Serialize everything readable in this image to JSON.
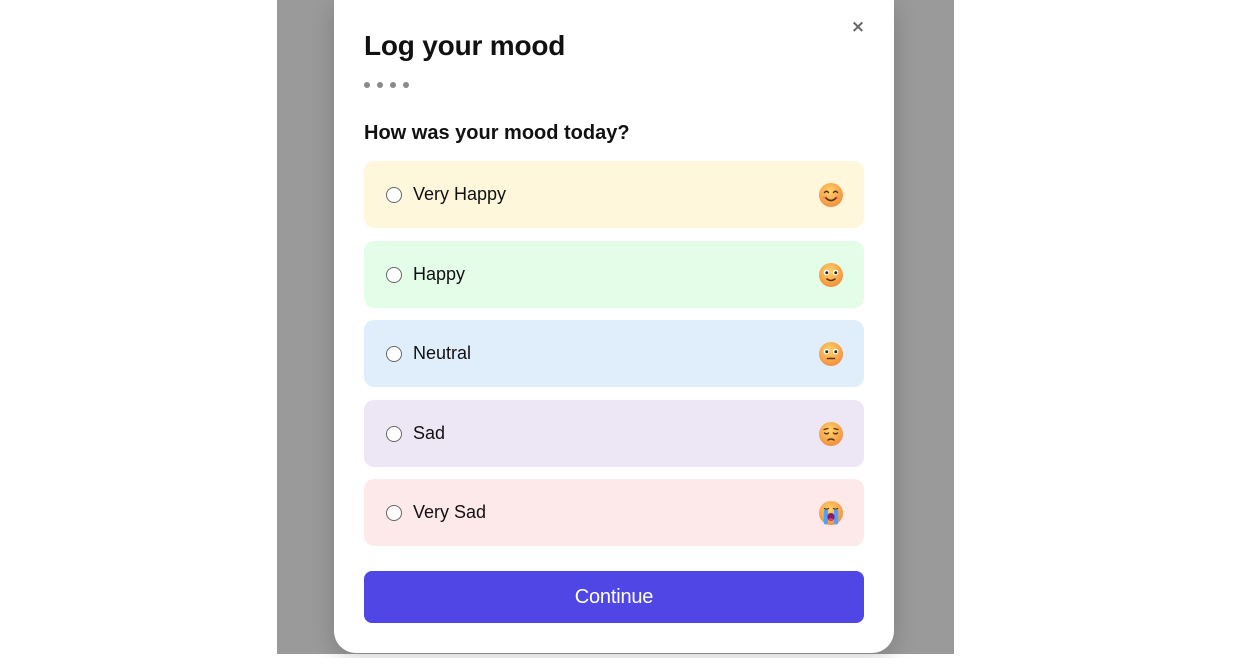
{
  "modal": {
    "title": "Log your mood",
    "close_glyph": "×",
    "step_count": 4,
    "question": "How was your mood today?",
    "continue_label": "Continue"
  },
  "options": [
    {
      "label": "Very Happy",
      "icon": "smiling-face-icon",
      "bg": "#fff7db"
    },
    {
      "label": "Happy",
      "icon": "slightly-smiling-face-icon",
      "bg": "#e3fde8"
    },
    {
      "label": "Neutral",
      "icon": "neutral-face-icon",
      "bg": "#e0eefc"
    },
    {
      "label": "Sad",
      "icon": "pensive-face-icon",
      "bg": "#ede6f5"
    },
    {
      "label": "Very Sad",
      "icon": "crying-face-icon",
      "bg": "#fde8ea"
    }
  ],
  "colors": {
    "overlay": "#9a9a9a",
    "accent": "#5046e5",
    "emoji_face": "#f7b54b"
  }
}
